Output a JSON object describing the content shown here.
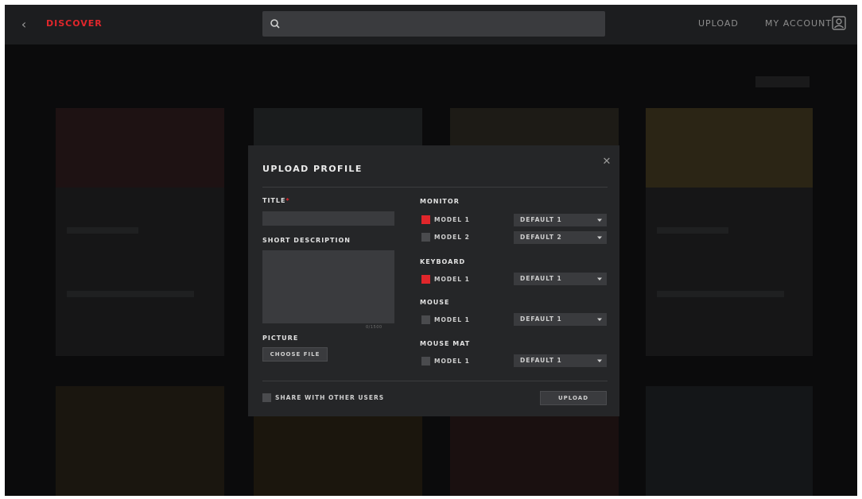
{
  "header": {
    "back_icon": "chevron-left-icon",
    "brand": "DISCOVER",
    "search": {
      "placeholder": "",
      "icon": "search-icon"
    },
    "upload_link": "UPLOAD",
    "account_link": "MY ACCOUNT",
    "account_icon": "user-icon"
  },
  "modal": {
    "title": "UPLOAD PROFILE",
    "close_icon": "close-icon",
    "title_field": {
      "label": "TITLE",
      "required_mark": "*",
      "value": ""
    },
    "description_field": {
      "label": "SHORT DESCRIPTION",
      "value": "",
      "counter": "0/1500"
    },
    "picture": {
      "label": "PICTURE",
      "button": "CHOOSE FILE"
    },
    "devices": [
      {
        "label": "MONITOR",
        "models": [
          {
            "name": "MODEL 1",
            "checked": true,
            "profile": "DEFAULT 1"
          },
          {
            "name": "MODEL 2",
            "checked": false,
            "profile": "DEFAULT 2"
          }
        ]
      },
      {
        "label": "KEYBOARD",
        "models": [
          {
            "name": "MODEL 1",
            "checked": true,
            "profile": "DEFAULT 1"
          }
        ]
      },
      {
        "label": "MOUSE",
        "models": [
          {
            "name": "MODEL 1",
            "checked": false,
            "profile": "DEFAULT 1"
          }
        ]
      },
      {
        "label": "MOUSE MAT",
        "models": [
          {
            "name": "MODEL 1",
            "checked": false,
            "profile": "DEFAULT 1"
          }
        ]
      }
    ],
    "share": {
      "label": "SHARE WITH OTHER USERS",
      "checked": false
    },
    "upload_button": "UPLOAD"
  },
  "colors": {
    "accent": "#e0262b",
    "topbar": "#1c1d1f",
    "modal": "#252628",
    "field": "#3a3b3e"
  }
}
